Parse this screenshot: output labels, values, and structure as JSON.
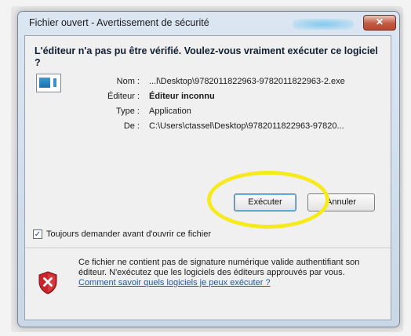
{
  "window": {
    "title": "Fichier ouvert - Avertissement de sécurité",
    "close_glyph": "✕"
  },
  "headline": "L'éditeur n'a pas pu être vérifié. Voulez-vous vraiment exécuter ce logiciel ?",
  "details": [
    {
      "label": "Nom :",
      "value": "...l\\Desktop\\9782011822963-9782011822963-2.exe",
      "bold": false
    },
    {
      "label": "Éditeur :",
      "value": "Éditeur inconnu",
      "bold": true
    },
    {
      "label": "Type :",
      "value": "Application",
      "bold": false
    },
    {
      "label": "De :",
      "value": "C:\\Users\\ctassel\\Desktop\\9782011822963-97820...",
      "bold": false
    }
  ],
  "buttons": {
    "run": "Exécuter",
    "cancel": "Annuler"
  },
  "checkbox": {
    "label": "Toujours demander avant d'ouvrir ce fichier",
    "checked": true,
    "glyph": "✓"
  },
  "warning": {
    "text": "Ce fichier ne contient pas de signature numérique valide authentifiant son éditeur. N'exécutez que les logiciels des éditeurs approuvés par vous. ",
    "link": "Comment savoir quels logiciels je peux exécuter ?"
  },
  "colors": {
    "highlight": "#f6ea1d",
    "link": "#1c5aa8",
    "shield": "#c8242b"
  },
  "icons": [
    "file-icon",
    "shield-error-icon",
    "close-icon",
    "checkmark-icon"
  ]
}
